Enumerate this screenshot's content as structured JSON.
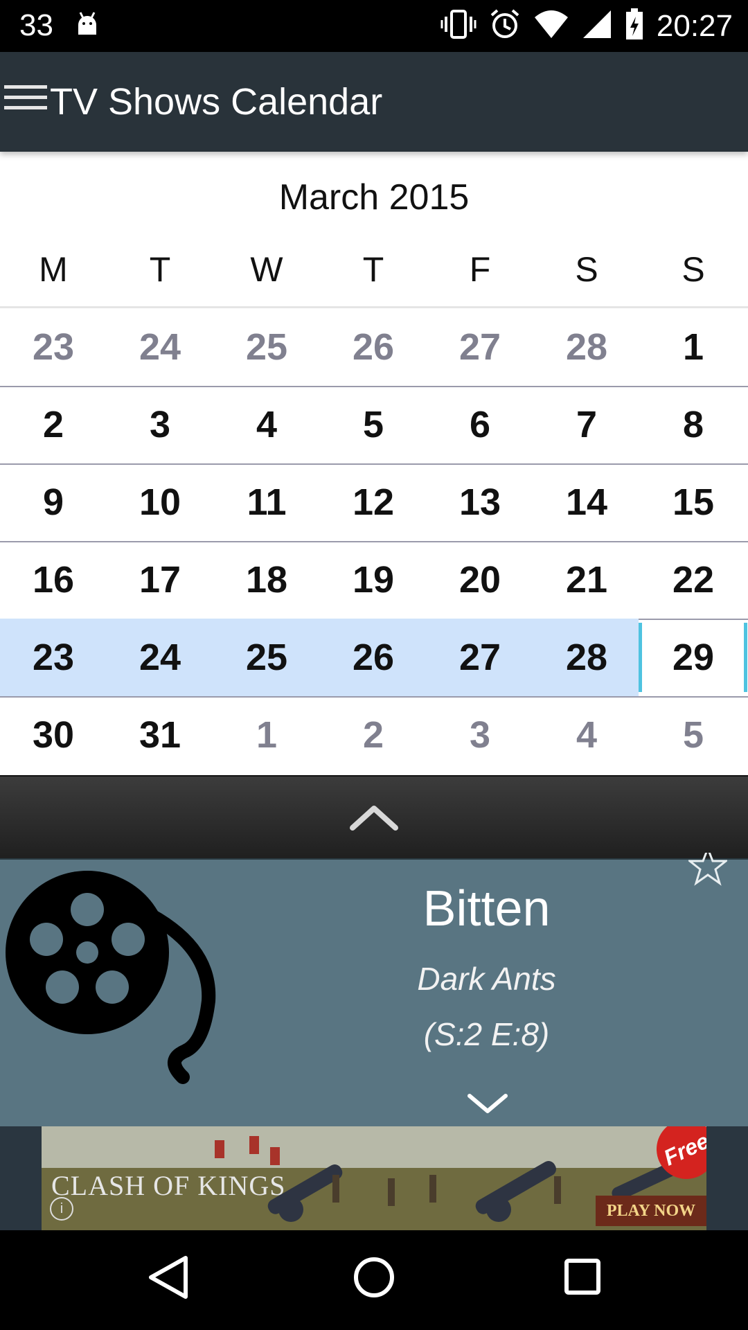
{
  "status_bar": {
    "left_number": "33",
    "time": "20:27",
    "icons": [
      "android-debug-icon",
      "vibrate-icon",
      "alarm-icon",
      "wifi-icon",
      "signal-icon",
      "battery-charging-icon"
    ]
  },
  "app_bar": {
    "title": "TV Shows Calendar",
    "menu_icon": "hamburger-menu-icon"
  },
  "calendar": {
    "month_title": "March 2015",
    "weekdays": [
      "M",
      "T",
      "W",
      "T",
      "F",
      "S",
      "S"
    ],
    "weeks": [
      [
        {
          "d": "23",
          "other": true
        },
        {
          "d": "24",
          "other": true
        },
        {
          "d": "25",
          "other": true
        },
        {
          "d": "26",
          "other": true
        },
        {
          "d": "27",
          "other": true
        },
        {
          "d": "28",
          "other": true
        },
        {
          "d": "1",
          "other": false
        }
      ],
      [
        {
          "d": "2",
          "other": false
        },
        {
          "d": "3",
          "other": false
        },
        {
          "d": "4",
          "other": false
        },
        {
          "d": "5",
          "other": false
        },
        {
          "d": "6",
          "other": false
        },
        {
          "d": "7",
          "other": false
        },
        {
          "d": "8",
          "other": false
        }
      ],
      [
        {
          "d": "9",
          "other": false
        },
        {
          "d": "10",
          "other": false
        },
        {
          "d": "11",
          "other": false
        },
        {
          "d": "12",
          "other": false
        },
        {
          "d": "13",
          "other": false
        },
        {
          "d": "14",
          "other": false
        },
        {
          "d": "15",
          "other": false
        }
      ],
      [
        {
          "d": "16",
          "other": false
        },
        {
          "d": "17",
          "other": false
        },
        {
          "d": "18",
          "other": false
        },
        {
          "d": "19",
          "other": false
        },
        {
          "d": "20",
          "other": false
        },
        {
          "d": "21",
          "other": false
        },
        {
          "d": "22",
          "other": false
        }
      ],
      [
        {
          "d": "23",
          "other": false
        },
        {
          "d": "24",
          "other": false
        },
        {
          "d": "25",
          "other": false
        },
        {
          "d": "26",
          "other": false
        },
        {
          "d": "27",
          "other": false
        },
        {
          "d": "28",
          "other": false
        },
        {
          "d": "29",
          "other": false
        }
      ],
      [
        {
          "d": "30",
          "other": false
        },
        {
          "d": "31",
          "other": false
        },
        {
          "d": "1",
          "other": true
        },
        {
          "d": "2",
          "other": true
        },
        {
          "d": "3",
          "other": true
        },
        {
          "d": "4",
          "other": true
        },
        {
          "d": "5",
          "other": true
        }
      ]
    ],
    "highlight_week_index": 4,
    "selected_day": "29",
    "colors": {
      "highlight": "#cfe3fb",
      "selected_border": "#4fc3e0",
      "other_month": "#80808f"
    }
  },
  "episode_card": {
    "show_title": "Bitten",
    "episode_title": "Dark Ants",
    "episode_code": "(S:2 E:8)",
    "thumbnail_icon": "film-reel-icon",
    "favorite_icon": "star-outline-icon",
    "expand_icon": "chevron-down-icon",
    "background": "#597582"
  },
  "drawer_handle": {
    "icon": "chevron-up-icon"
  },
  "ad_banner": {
    "logo_text": "CLASH OF KINGS",
    "badge": "Free",
    "cta": "PLAY NOW",
    "info_icon": "info-icon"
  },
  "nav_bar": {
    "buttons": [
      "back-icon",
      "home-icon",
      "recents-icon"
    ]
  }
}
